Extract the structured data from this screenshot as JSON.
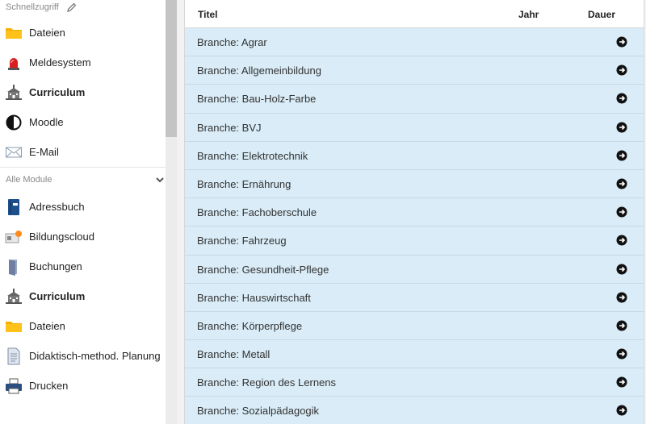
{
  "sidebar": {
    "quick_access_label": "Schnellzugriff",
    "quick_access": [
      {
        "label": "Dateien",
        "icon": "folder-icon",
        "bold": false
      },
      {
        "label": "Meldesystem",
        "icon": "siren-icon",
        "bold": false
      },
      {
        "label": "Curriculum",
        "icon": "school-building-icon",
        "bold": true
      },
      {
        "label": "Moodle",
        "icon": "half-circle-icon",
        "bold": false
      },
      {
        "label": "E-Mail",
        "icon": "envelope-icon",
        "bold": false
      }
    ],
    "all_modules_label": "Alle Module",
    "all_modules": [
      {
        "label": "Adressbuch",
        "icon": "address-book-icon",
        "bold": false
      },
      {
        "label": "Bildungscloud",
        "icon": "cloud-card-icon",
        "bold": false
      },
      {
        "label": "Buchungen",
        "icon": "door-icon",
        "bold": false
      },
      {
        "label": "Curriculum",
        "icon": "school-building-icon",
        "bold": true
      },
      {
        "label": "Dateien",
        "icon": "folder-icon",
        "bold": false
      },
      {
        "label": "Didaktisch-method. Planung",
        "icon": "document-icon",
        "bold": false
      },
      {
        "label": "Drucken",
        "icon": "printer-icon",
        "bold": false
      }
    ]
  },
  "table": {
    "headers": {
      "title": "Titel",
      "year": "Jahr",
      "duration": "Dauer"
    },
    "rows": [
      "Branche: Agrar",
      "Branche: Allgemeinbildung",
      "Branche: Bau-Holz-Farbe",
      "Branche: BVJ",
      "Branche: Elektrotechnik",
      "Branche: Ernährung",
      "Branche: Fachoberschule",
      "Branche: Fahrzeug",
      "Branche: Gesundheit-Pflege",
      "Branche: Hauswirtschaft",
      "Branche: Körperpflege",
      "Branche: Metall",
      "Branche: Region des Lernens",
      "Branche: Sozialpädagogik"
    ]
  },
  "colors": {
    "row_bg": "#d9ecf7",
    "folder": "#f5b000"
  }
}
